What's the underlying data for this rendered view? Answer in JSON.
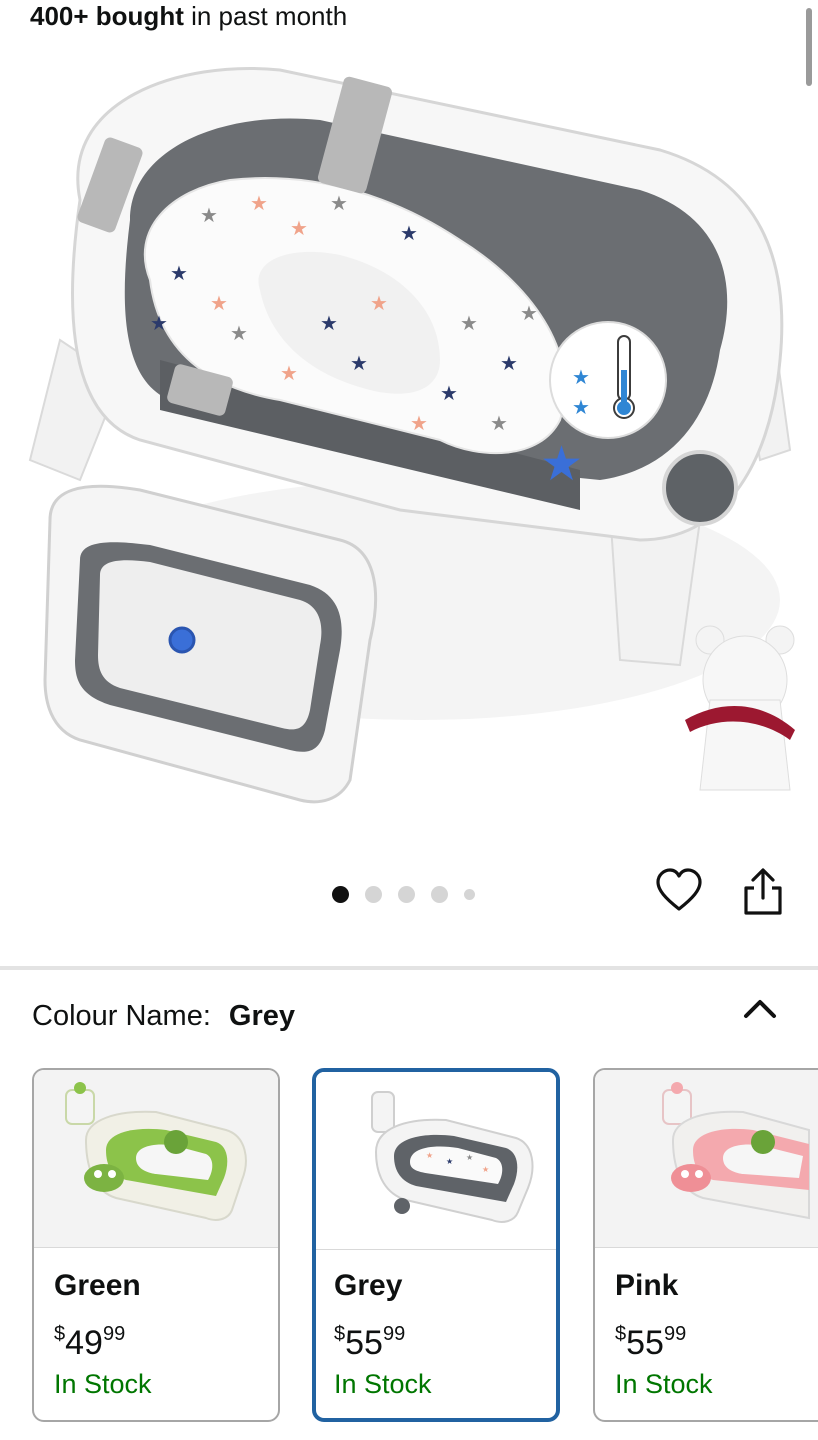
{
  "social_proof": {
    "bold": "400+ bought",
    "rest": " in past month"
  },
  "gallery": {
    "image_count": 5,
    "active_index": 0
  },
  "actions": {
    "favorite_icon": "heart-outline-icon",
    "share_icon": "share-icon"
  },
  "colour": {
    "label": "Colour Name:",
    "selected": "Grey",
    "toggle_icon": "chevron-up-icon"
  },
  "variants": [
    {
      "name": "Green",
      "currency": "$",
      "price_whole": "49",
      "price_cents": "99",
      "stock": "In Stock",
      "accent": "#8cc34a"
    },
    {
      "name": "Grey",
      "currency": "$",
      "price_whole": "55",
      "price_cents": "99",
      "stock": "In Stock",
      "accent": "#5f6368"
    },
    {
      "name": "Pink",
      "currency": "$",
      "price_whole": "55",
      "price_cents": "99",
      "stock": "In Stock",
      "accent": "#f4a9ae"
    }
  ],
  "colors": {
    "selected_border": "#2162a1",
    "in_stock": "#007600",
    "divider": "#e3e3e3"
  }
}
